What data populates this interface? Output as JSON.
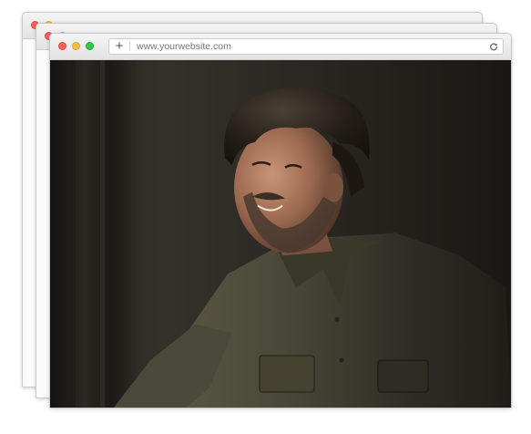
{
  "browser": {
    "url": "www.yourwebsite.com",
    "new_tab_symbol": "+",
    "traffic_lights": [
      "#fc605c",
      "#fdbc40",
      "#34c84a"
    ],
    "icons": [
      "close-icon",
      "minimize-icon",
      "zoom-icon",
      "plus-icon",
      "reload-icon"
    ]
  },
  "content": {
    "image_subject": "Portrait photo of a smiling bearded man with dark curly hair in an olive-green shirt, lit from the left against a dark background"
  }
}
